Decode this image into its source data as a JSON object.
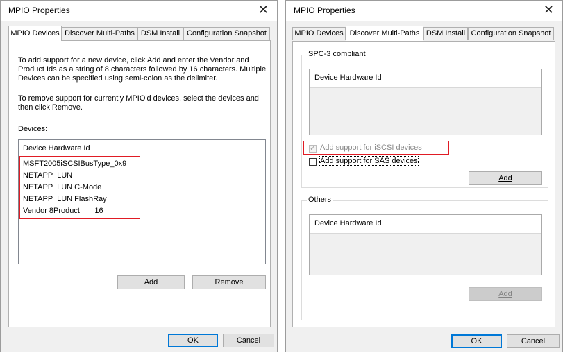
{
  "left_dialog": {
    "title": "MPIO Properties",
    "tabs": [
      "MPIO Devices",
      "Discover Multi-Paths",
      "DSM Install",
      "Configuration Snapshot"
    ],
    "instructions_add_lines": [
      "To add support for a new device, click Add and enter the Vendor and",
      "Product Ids as a string of 8 characters followed by 16 characters. Multiple",
      "Devices can be specified using semi-colon as the delimiter."
    ],
    "instructions_remove_lines": [
      "To remove support for currently MPIO'd devices, select the devices and",
      "then click Remove."
    ],
    "devices_label": "Devices:",
    "list_header": "Device Hardware Id",
    "devices": [
      "MSFT2005iSCSIBusType_0x9",
      "NETAPP  LUN",
      "NETAPP  LUN C-Mode",
      "NETAPP  LUN FlashRay",
      "Vendor 8Product       16"
    ],
    "add_label": "Add",
    "remove_label": "Remove",
    "ok_label": "OK",
    "cancel_label": "Cancel"
  },
  "right_dialog": {
    "title": "MPIO Properties",
    "tabs": [
      "MPIO Devices",
      "Discover Multi-Paths",
      "DSM Install",
      "Configuration Snapshot"
    ],
    "spc_group_label": "SPC-3 compliant",
    "spc_list_header": "Device Hardware Id",
    "iscsi_label": "Add support for iSCSI devices",
    "iscsi_checked": true,
    "iscsi_enabled": false,
    "sas_label": "Add support for SAS devices",
    "sas_checked": false,
    "add_label": "Add",
    "others_group_label": "Others",
    "others_list_header": "Device Hardware Id",
    "add2_label": "Add",
    "ok_label": "OK",
    "cancel_label": "Cancel"
  },
  "colors": {
    "highlight_box": "#e01b24",
    "default_button_border": "#0078d7"
  }
}
